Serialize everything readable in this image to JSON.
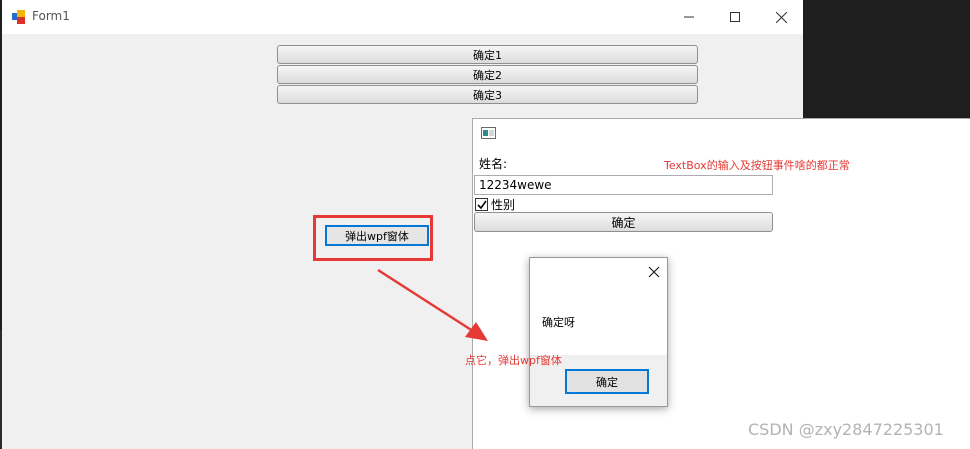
{
  "form1": {
    "title": "Form1",
    "buttons": [
      "确定1",
      "确定2",
      "确定3"
    ],
    "popup_button": "弹出wpf窗体"
  },
  "wpf_window": {
    "name_label": "姓名:",
    "name_value": "12234wewe",
    "gender_label": "性别",
    "gender_checked": true,
    "ok_button": "确定",
    "note": "TextBox的输入及按钮事件啥的都正常"
  },
  "msg_dialog": {
    "text": "确定呀",
    "ok_button": "确定"
  },
  "annotations": {
    "arrow_label": "点它，弹出wpf窗体",
    "accent_color": "#e53935"
  },
  "watermark": "CSDN @zxy2847225301",
  "icons": [
    "form-app-icon",
    "minimize-icon",
    "maximize-icon",
    "close-icon",
    "wpf-window-icon",
    "checkmark-icon",
    "dialog-close-icon",
    "red-arrow"
  ]
}
